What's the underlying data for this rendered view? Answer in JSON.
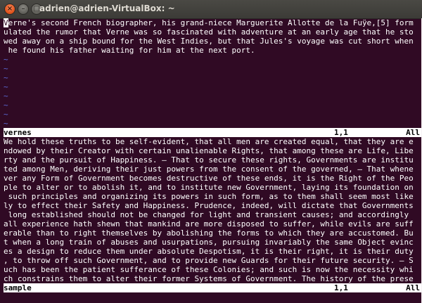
{
  "window": {
    "title": "adrien@adrien-VirtualBox: ~",
    "close_glyph": "×",
    "minimize_glyph": "–",
    "maximize_glyph": "□"
  },
  "top_pane": {
    "cursor_char": "V",
    "first_line_rest": "erne's second French biographer, his grand-niece Marguerite Allotte de la Fuÿe,[5] form",
    "lines": [
      "ulated the rumor that Verne was so fascinated with adventure at an early age that he sto",
      "wed away on a ship bound for the West Indies, but that Jules's voyage was cut short when",
      " he found his father waiting for him at the next port."
    ],
    "empty_marker": "~",
    "status": {
      "filename": "vernes",
      "position": "1,1",
      "scroll": "All"
    }
  },
  "bottom_pane": {
    "lines": [
      "We hold these truths to be self-evident, that all men are created equal, that they are e",
      "ndowed by their Creator with certain unalienable Rights, that among these are Life, Libe",
      "rty and the pursuit of Happiness. — That to secure these rights, Governments are institu",
      "ted among Men, deriving their just powers from the consent of the governed, — That whene",
      "ver any Form of Government becomes destructive of these ends, it is the Right of the Peo",
      "ple to alter or to abolish it, and to institute new Government, laying its foundation on",
      " such principles and organizing its powers in such form, as to them shall seem most like",
      "ly to effect their Safety and Happiness. Prudence, indeed, will dictate that Governments",
      " long established should not be changed for light and transient causes; and accordingly",
      "all experience hath shewn that mankind are more disposed to suffer, while evils are suff",
      "erable than to right themselves by abolishing the forms to which they are accustomed. Bu",
      "t when a long train of abuses and usurpations, pursuing invariably the same Object evinc",
      "es a design to reduce them under absolute Despotism, it is their right, it is their duty",
      ", to throw off such Government, and to provide new Guards for their future security. — S",
      "uch has been the patient sufferance of these Colonies; and such is now the necessity whi",
      "ch constrains them to alter their former Systems of Government. The history of the prese"
    ],
    "status": {
      "filename": "sample",
      "position": "1,1",
      "scroll": "All"
    }
  },
  "colors": {
    "terminal_bg": "#300a24",
    "text": "#ffffff",
    "tilde": "#5c6ad9",
    "statusline_bg": "#ffffff",
    "close_button": "#e2561f"
  }
}
